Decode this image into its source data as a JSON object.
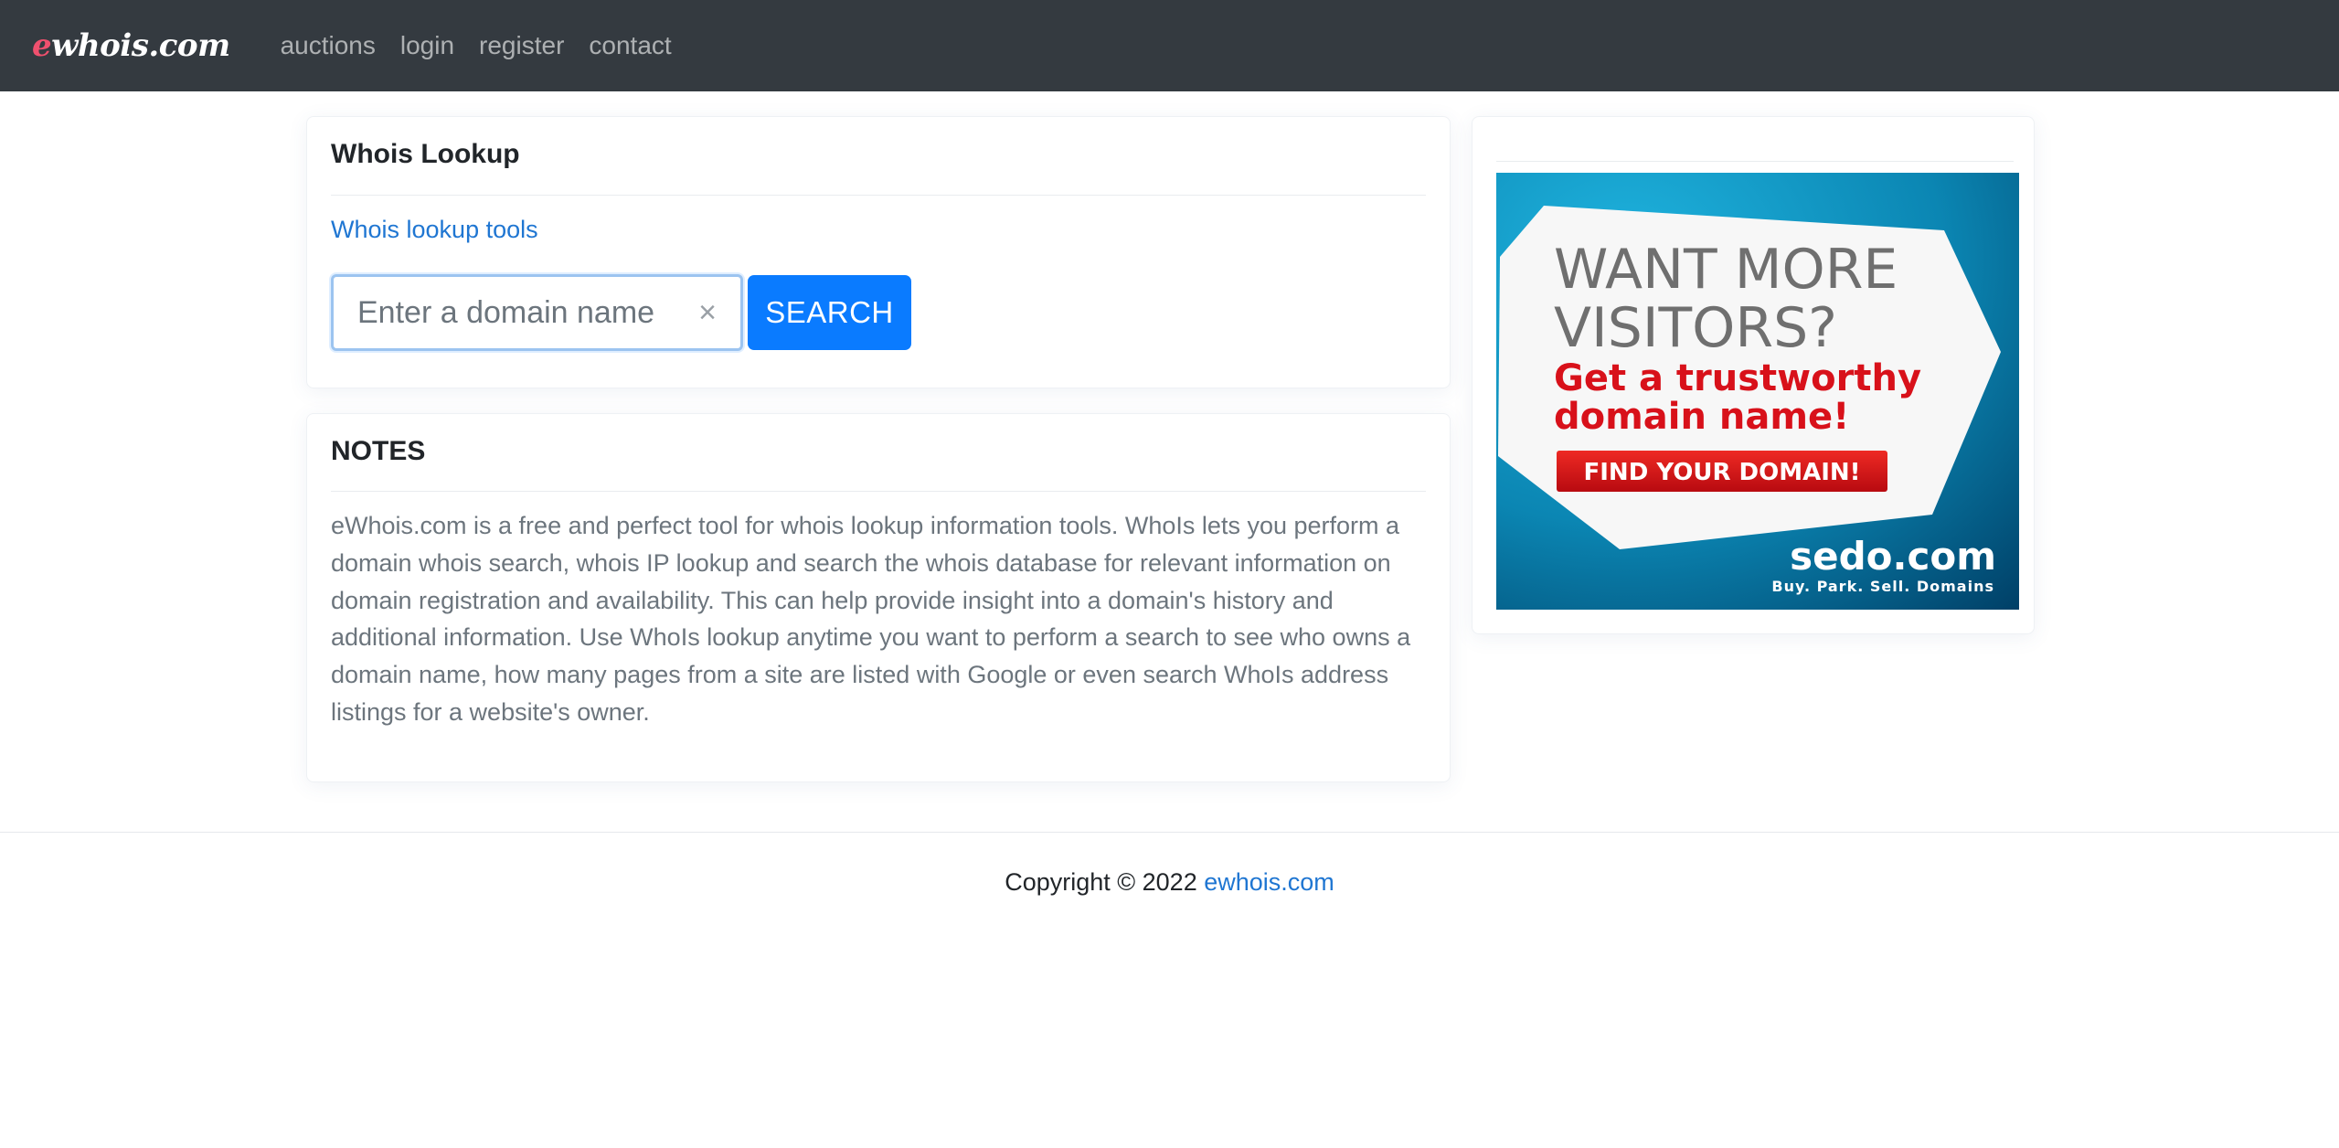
{
  "navbar": {
    "brand_accent": "e",
    "brand_rest": "whois.com",
    "links": [
      "auctions",
      "login",
      "register",
      "contact"
    ]
  },
  "lookup": {
    "title": "Whois Lookup",
    "tools_link": "Whois lookup tools",
    "search_placeholder": "Enter a domain name",
    "clear_icon": "×",
    "search_button": "SEARCH"
  },
  "notes": {
    "title": "NOTES",
    "text": "eWhois.com is a free and perfect tool for whois lookup information tools. WhoIs lets you perform a domain whois search, whois IP lookup and search the whois database for relevant information on domain registration and availability. This can help provide insight into a domain's history and additional information. Use WhoIs lookup anytime you want to perform a search to see who owns a domain name, how many pages from a site are listed with Google or even search WhoIs address listings for a website's owner."
  },
  "ad": {
    "headline_1": "WANT MORE",
    "headline_2": "VISITORS?",
    "subhead_1": "Get a trustworthy",
    "subhead_2": "domain name!",
    "button": "FIND YOUR DOMAIN!",
    "brand": "sedo.com",
    "tagline": "Buy. Park. Sell. Domains"
  },
  "footer": {
    "copyright": "Copyright © 2022",
    "link": "ewhois.com"
  },
  "colors": {
    "navbar_bg": "#343a40",
    "brand_accent": "#f0506e",
    "link": "#1f76d2",
    "primary_button": "#0a7bff",
    "ad_red": "#d8111a",
    "ad_blue": "#0d7ea6"
  }
}
